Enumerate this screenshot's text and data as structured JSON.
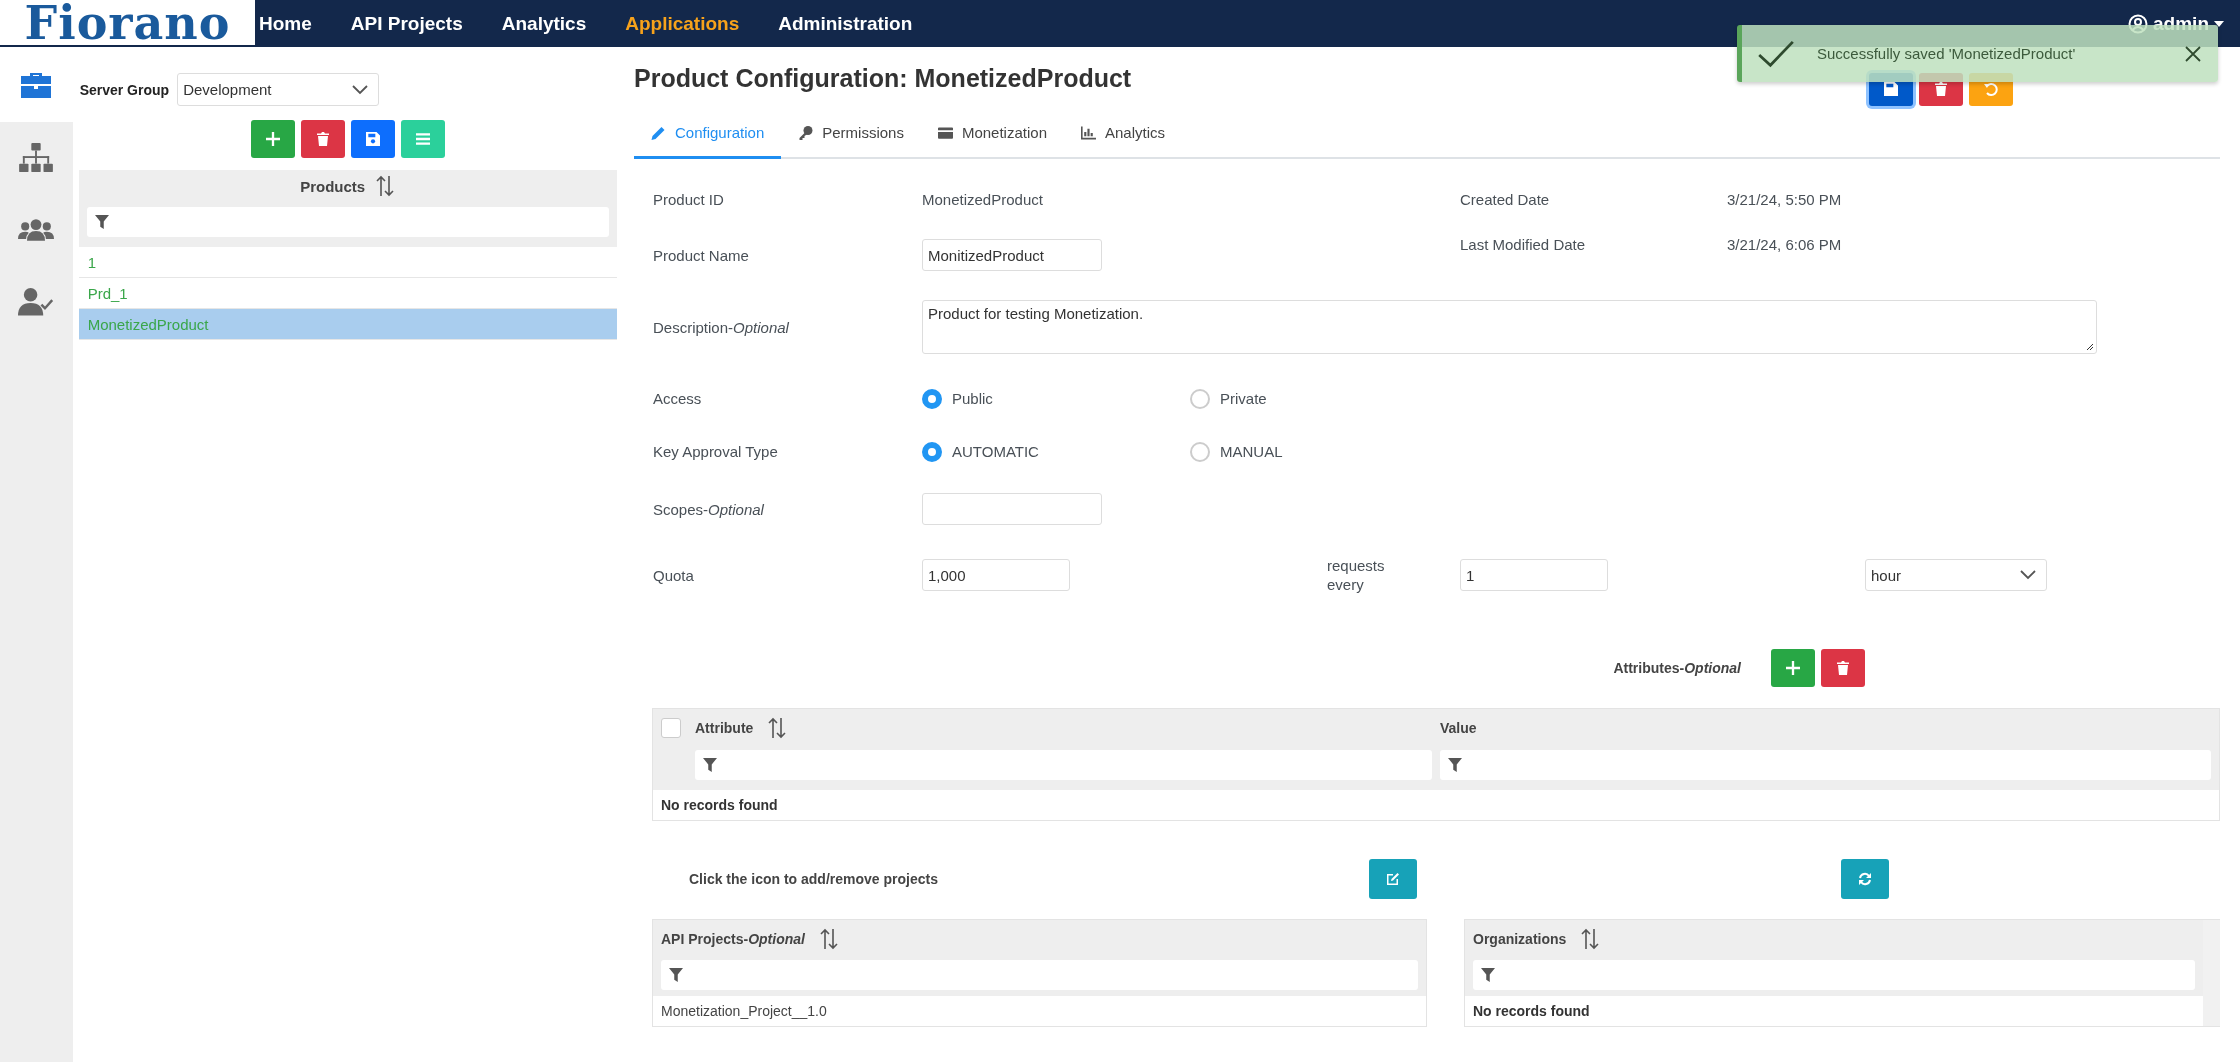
{
  "brand": {
    "logo": "Fiorano"
  },
  "nav": [
    {
      "label": "Home",
      "selected": false
    },
    {
      "label": "API Projects",
      "selected": false
    },
    {
      "label": "Analytics",
      "selected": false
    },
    {
      "label": "Applications",
      "selected": true
    },
    {
      "label": "Administration",
      "selected": false
    }
  ],
  "user": {
    "name": "admin"
  },
  "rail": [
    {
      "kind": "briefcase",
      "selected": true
    },
    {
      "kind": "hierarchy",
      "selected": false
    },
    {
      "kind": "group",
      "selected": false
    },
    {
      "kind": "user-check",
      "selected": false
    }
  ],
  "server_group": {
    "label": "Server Group",
    "value": "Development"
  },
  "products": {
    "column": "Products",
    "rows": [
      {
        "name": "1",
        "selected": false
      },
      {
        "name": "Prd_1",
        "selected": false
      },
      {
        "name": "MonetizedProduct",
        "selected": true
      }
    ]
  },
  "page_title": "Product Configuration: MonetizedProduct",
  "tabs": [
    {
      "label": "Configuration",
      "kind": "pencil",
      "selected": true
    },
    {
      "label": "Permissions",
      "kind": "key",
      "selected": false
    },
    {
      "label": "Monetization",
      "kind": "card",
      "selected": false
    },
    {
      "label": "Analytics",
      "kind": "chart",
      "selected": false
    }
  ],
  "form": {
    "product_id": {
      "label": "Product ID",
      "value": "MonetizedProduct"
    },
    "created_date": {
      "label": "Created Date",
      "value": "3/21/24, 5:50 PM"
    },
    "product_name": {
      "label": "Product Name",
      "value": "MonitizedProduct"
    },
    "last_modified": {
      "label": "Last Modified Date",
      "value": "3/21/24, 6:06 PM"
    },
    "description": {
      "label": "Description-*Optional*",
      "value": "Product for testing Monetization."
    },
    "access": {
      "label": "Access",
      "options": [
        {
          "label": "Public",
          "selected": true
        },
        {
          "label": "Private",
          "selected": false
        }
      ]
    },
    "key_approval": {
      "label": "Key Approval Type",
      "options": [
        {
          "label": "AUTOMATIC",
          "selected": true
        },
        {
          "label": "MANUAL",
          "selected": false
        }
      ]
    },
    "scopes": {
      "label": "Scopes-*Optional*"
    },
    "quota": {
      "label": "Quota",
      "value": "1,000",
      "every_label": "requests every",
      "interval": "1",
      "unit": "hour"
    }
  },
  "attributes": {
    "title": "Attributes-*Optional*",
    "select_all_checked": false,
    "columns": [
      {
        "label": "Attribute"
      },
      {
        "label": "Value"
      }
    ],
    "empty": "No records found"
  },
  "projects": {
    "hint": "Click the icon to add/remove projects",
    "api_projects": {
      "title": "API Projects-*Optional*",
      "rows": [
        "Monetization_Project__1.0"
      ]
    },
    "organizations": {
      "title": "Organizations",
      "empty": "No records found"
    }
  },
  "toast": {
    "message": "Successfully saved 'MonetizedProduct'"
  }
}
